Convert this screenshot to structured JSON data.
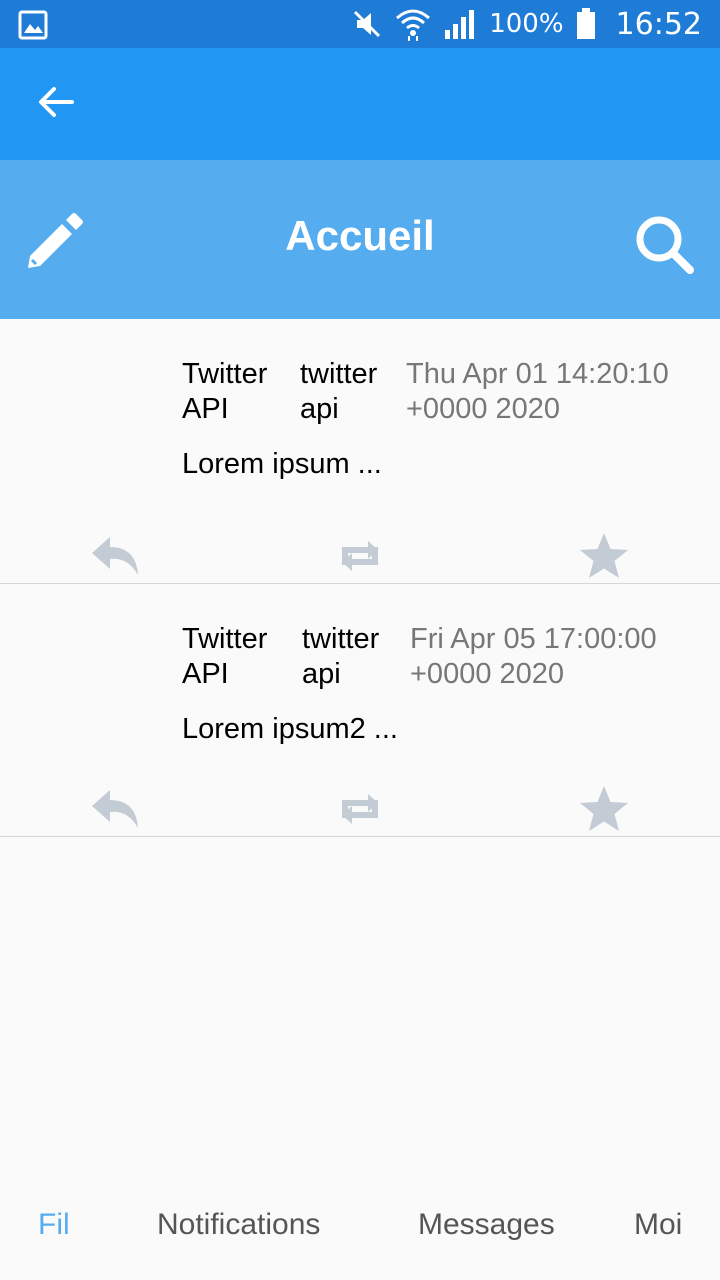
{
  "status_bar": {
    "battery": "100%",
    "time": "16:52"
  },
  "header": {
    "title": "Accueil"
  },
  "tweets": [
    {
      "name": "Twitter API",
      "handle": "twitter api",
      "date": "Thu Apr 01 14:20:10 +0000 2020",
      "text": "Lorem ipsum ..."
    },
    {
      "name": "Twitter API",
      "handle": "twitter api",
      "date": "Fri Apr 05 17:00:00 +0000 2020",
      "text": "Lorem ipsum2 ..."
    }
  ],
  "tabs": [
    {
      "label": "Fil",
      "active": true
    },
    {
      "label": "Notifications",
      "active": false
    },
    {
      "label": "Messages",
      "active": false
    },
    {
      "label": "Moi",
      "active": false
    }
  ],
  "colors": {
    "status_bar": "#1e7bd6",
    "app_bar": "#2196f3",
    "header": "#55acee",
    "action_icon": "#c3ccd4",
    "active_tab": "#55acee"
  },
  "icons": {
    "status_left": "gallery-icon",
    "mute": "mute-icon",
    "wifi": "wifi-icon",
    "signal": "signal-icon",
    "battery": "battery-icon",
    "back": "back-arrow-icon",
    "compose": "pencil-icon",
    "search": "search-icon",
    "reply": "reply-icon",
    "retweet": "retweet-icon",
    "favorite": "star-icon"
  }
}
